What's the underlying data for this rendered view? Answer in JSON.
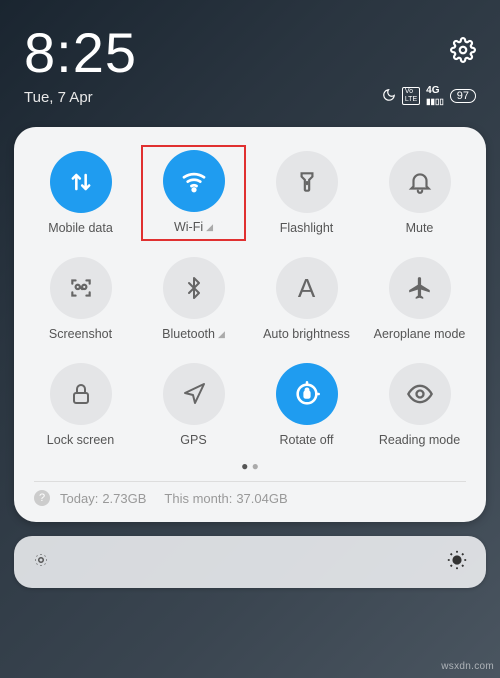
{
  "status": {
    "time": "8:25",
    "date": "Tue, 7 Apr",
    "dnd_icon": "dnd-moon",
    "volte": "VoLTE",
    "signal": "4G",
    "battery": "97"
  },
  "tiles": [
    {
      "id": "mobile-data",
      "label": "Mobile data",
      "active": true,
      "chevron": false,
      "icon": "data-arrows"
    },
    {
      "id": "wifi",
      "label": "Wi-Fi",
      "active": true,
      "chevron": true,
      "icon": "wifi",
      "highlight": true
    },
    {
      "id": "flashlight",
      "label": "Flashlight",
      "active": false,
      "chevron": false,
      "icon": "flashlight"
    },
    {
      "id": "mute",
      "label": "Mute",
      "active": false,
      "chevron": false,
      "icon": "bell"
    },
    {
      "id": "screenshot",
      "label": "Screenshot",
      "active": false,
      "chevron": false,
      "icon": "screenshot"
    },
    {
      "id": "bluetooth",
      "label": "Bluetooth",
      "active": false,
      "chevron": true,
      "icon": "bluetooth"
    },
    {
      "id": "auto-brightness",
      "label": "Auto brightness",
      "active": false,
      "chevron": false,
      "icon": "letter-a"
    },
    {
      "id": "aeroplane",
      "label": "Aeroplane mode",
      "active": false,
      "chevron": false,
      "icon": "airplane"
    },
    {
      "id": "lock-screen",
      "label": "Lock screen",
      "active": false,
      "chevron": false,
      "icon": "lock"
    },
    {
      "id": "gps",
      "label": "GPS",
      "active": false,
      "chevron": false,
      "icon": "nav-arrow"
    },
    {
      "id": "rotate",
      "label": "Rotate off",
      "active": true,
      "chevron": false,
      "icon": "rotate-lock"
    },
    {
      "id": "reading",
      "label": "Reading mode",
      "active": false,
      "chevron": false,
      "icon": "eye"
    }
  ],
  "usage": {
    "today_label": "Today:",
    "today_value": "2.73GB",
    "month_label": "This month:",
    "month_value": "37.04GB"
  },
  "watermark": "wsxdn.com"
}
